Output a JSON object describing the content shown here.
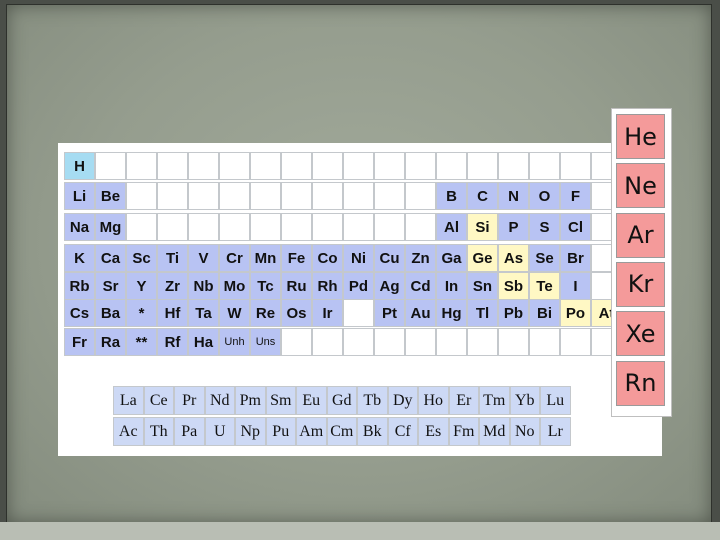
{
  "colors": {
    "h": "#a6dcf2",
    "alkali": "#b8c3f3",
    "metalloid": "#fff8c4",
    "lanthanide": "#cdd9f5",
    "empty": "#ffffff",
    "noble": "#f49a9a"
  },
  "main_rows": [
    [
      {
        "s": "H",
        "t": "h"
      }
    ],
    [
      {
        "s": "Li",
        "t": "alkali"
      },
      {
        "s": "Be",
        "t": "alkali"
      },
      {
        "s": "",
        "t": "empty"
      },
      {
        "s": "",
        "t": "empty"
      },
      {
        "s": "",
        "t": "empty"
      },
      {
        "s": "",
        "t": "empty"
      },
      {
        "s": "",
        "t": "empty"
      },
      {
        "s": "",
        "t": "empty"
      },
      {
        "s": "",
        "t": "empty"
      },
      {
        "s": "",
        "t": "empty"
      },
      {
        "s": "",
        "t": "empty"
      },
      {
        "s": "",
        "t": "empty"
      },
      {
        "s": "B",
        "t": "alkali"
      },
      {
        "s": "C",
        "t": "alkali"
      },
      {
        "s": "N",
        "t": "alkali"
      },
      {
        "s": "O",
        "t": "alkali"
      },
      {
        "s": "F",
        "t": "alkali"
      }
    ],
    [
      {
        "s": "Na",
        "t": "alkali"
      },
      {
        "s": "Mg",
        "t": "alkali"
      },
      {
        "s": "",
        "t": "empty"
      },
      {
        "s": "",
        "t": "empty"
      },
      {
        "s": "",
        "t": "empty"
      },
      {
        "s": "",
        "t": "empty"
      },
      {
        "s": "",
        "t": "empty"
      },
      {
        "s": "",
        "t": "empty"
      },
      {
        "s": "",
        "t": "empty"
      },
      {
        "s": "",
        "t": "empty"
      },
      {
        "s": "",
        "t": "empty"
      },
      {
        "s": "",
        "t": "empty"
      },
      {
        "s": "Al",
        "t": "alkali"
      },
      {
        "s": "Si",
        "t": "metalloid"
      },
      {
        "s": "P",
        "t": "alkali"
      },
      {
        "s": "S",
        "t": "alkali"
      },
      {
        "s": "Cl",
        "t": "alkali"
      }
    ],
    [
      {
        "s": "K",
        "t": "alkali"
      },
      {
        "s": "Ca",
        "t": "alkali"
      },
      {
        "s": "Sc",
        "t": "alkali"
      },
      {
        "s": "Ti",
        "t": "alkali"
      },
      {
        "s": "V",
        "t": "alkali"
      },
      {
        "s": "Cr",
        "t": "alkali"
      },
      {
        "s": "Mn",
        "t": "alkali"
      },
      {
        "s": "Fe",
        "t": "alkali"
      },
      {
        "s": "Co",
        "t": "alkali"
      },
      {
        "s": "Ni",
        "t": "alkali"
      },
      {
        "s": "Cu",
        "t": "alkali"
      },
      {
        "s": "Zn",
        "t": "alkali"
      },
      {
        "s": "Ga",
        "t": "alkali"
      },
      {
        "s": "Ge",
        "t": "metalloid"
      },
      {
        "s": "As",
        "t": "metalloid"
      },
      {
        "s": "Se",
        "t": "alkali"
      },
      {
        "s": "Br",
        "t": "alkali"
      }
    ],
    [
      {
        "s": "Rb",
        "t": "alkali"
      },
      {
        "s": "Sr",
        "t": "alkali"
      },
      {
        "s": "Y",
        "t": "alkali"
      },
      {
        "s": "Zr",
        "t": "alkali"
      },
      {
        "s": "Nb",
        "t": "alkali"
      },
      {
        "s": "Mo",
        "t": "alkali"
      },
      {
        "s": "Tc",
        "t": "alkali"
      },
      {
        "s": "Ru",
        "t": "alkali"
      },
      {
        "s": "Rh",
        "t": "alkali"
      },
      {
        "s": "Pd",
        "t": "alkali"
      },
      {
        "s": "Ag",
        "t": "alkali"
      },
      {
        "s": "Cd",
        "t": "alkali"
      },
      {
        "s": "In",
        "t": "alkali"
      },
      {
        "s": "Sn",
        "t": "alkali"
      },
      {
        "s": "Sb",
        "t": "metalloid"
      },
      {
        "s": "Te",
        "t": "metalloid"
      },
      {
        "s": "I",
        "t": "alkali"
      }
    ],
    [
      {
        "s": "Cs",
        "t": "alkali"
      },
      {
        "s": "Ba",
        "t": "alkali"
      },
      {
        "s": "*",
        "t": "alkali"
      },
      {
        "s": "Hf",
        "t": "alkali"
      },
      {
        "s": "Ta",
        "t": "alkali"
      },
      {
        "s": "W",
        "t": "alkali"
      },
      {
        "s": "Re",
        "t": "alkali"
      },
      {
        "s": "Os",
        "t": "alkali"
      },
      {
        "s": "Ir",
        "t": "alkali"
      },
      {
        "s": "",
        "t": "empty"
      },
      {
        "s": "Pt",
        "t": "alkali"
      },
      {
        "s": "Au",
        "t": "alkali"
      },
      {
        "s": "Hg",
        "t": "alkali"
      },
      {
        "s": "Tl",
        "t": "alkali"
      },
      {
        "s": "Pb",
        "t": "alkali"
      },
      {
        "s": "Bi",
        "t": "alkali"
      },
      {
        "s": "Po",
        "t": "metalloid"
      },
      {
        "s": "At",
        "t": "metalloid"
      }
    ],
    [
      {
        "s": "Fr",
        "t": "alkali"
      },
      {
        "s": "Ra",
        "t": "alkali"
      },
      {
        "s": "**",
        "t": "alkali"
      },
      {
        "s": "Rf",
        "t": "alkali"
      },
      {
        "s": "Ha",
        "t": "alkali"
      },
      {
        "s": "Unh",
        "t": "alkali",
        "small": true
      },
      {
        "s": "Uns",
        "t": "alkali",
        "small": true
      },
      {
        "s": "",
        "t": "empty"
      },
      {
        "s": "",
        "t": "empty"
      },
      {
        "s": "",
        "t": "empty"
      },
      {
        "s": "",
        "t": "empty"
      },
      {
        "s": "",
        "t": "empty"
      },
      {
        "s": "",
        "t": "empty"
      },
      {
        "s": "",
        "t": "empty"
      },
      {
        "s": "",
        "t": "empty"
      },
      {
        "s": "",
        "t": "empty"
      },
      {
        "s": "",
        "t": "empty"
      }
    ]
  ],
  "lanthanides": [
    "La",
    "Ce",
    "Pr",
    "Nd",
    "Pm",
    "Sm",
    "Eu",
    "Gd",
    "Tb",
    "Dy",
    "Ho",
    "Er",
    "Tm",
    "Yb",
    "Lu"
  ],
  "actinides": [
    "Ac",
    "Th",
    "Pa",
    "U",
    "Np",
    "Pu",
    "Am",
    "Cm",
    "Bk",
    "Cf",
    "Es",
    "Fm",
    "Md",
    "No",
    "Lr"
  ],
  "noble_gases": [
    "He",
    "Ne",
    "Ar",
    "Kr",
    "Xe",
    "Rn"
  ]
}
